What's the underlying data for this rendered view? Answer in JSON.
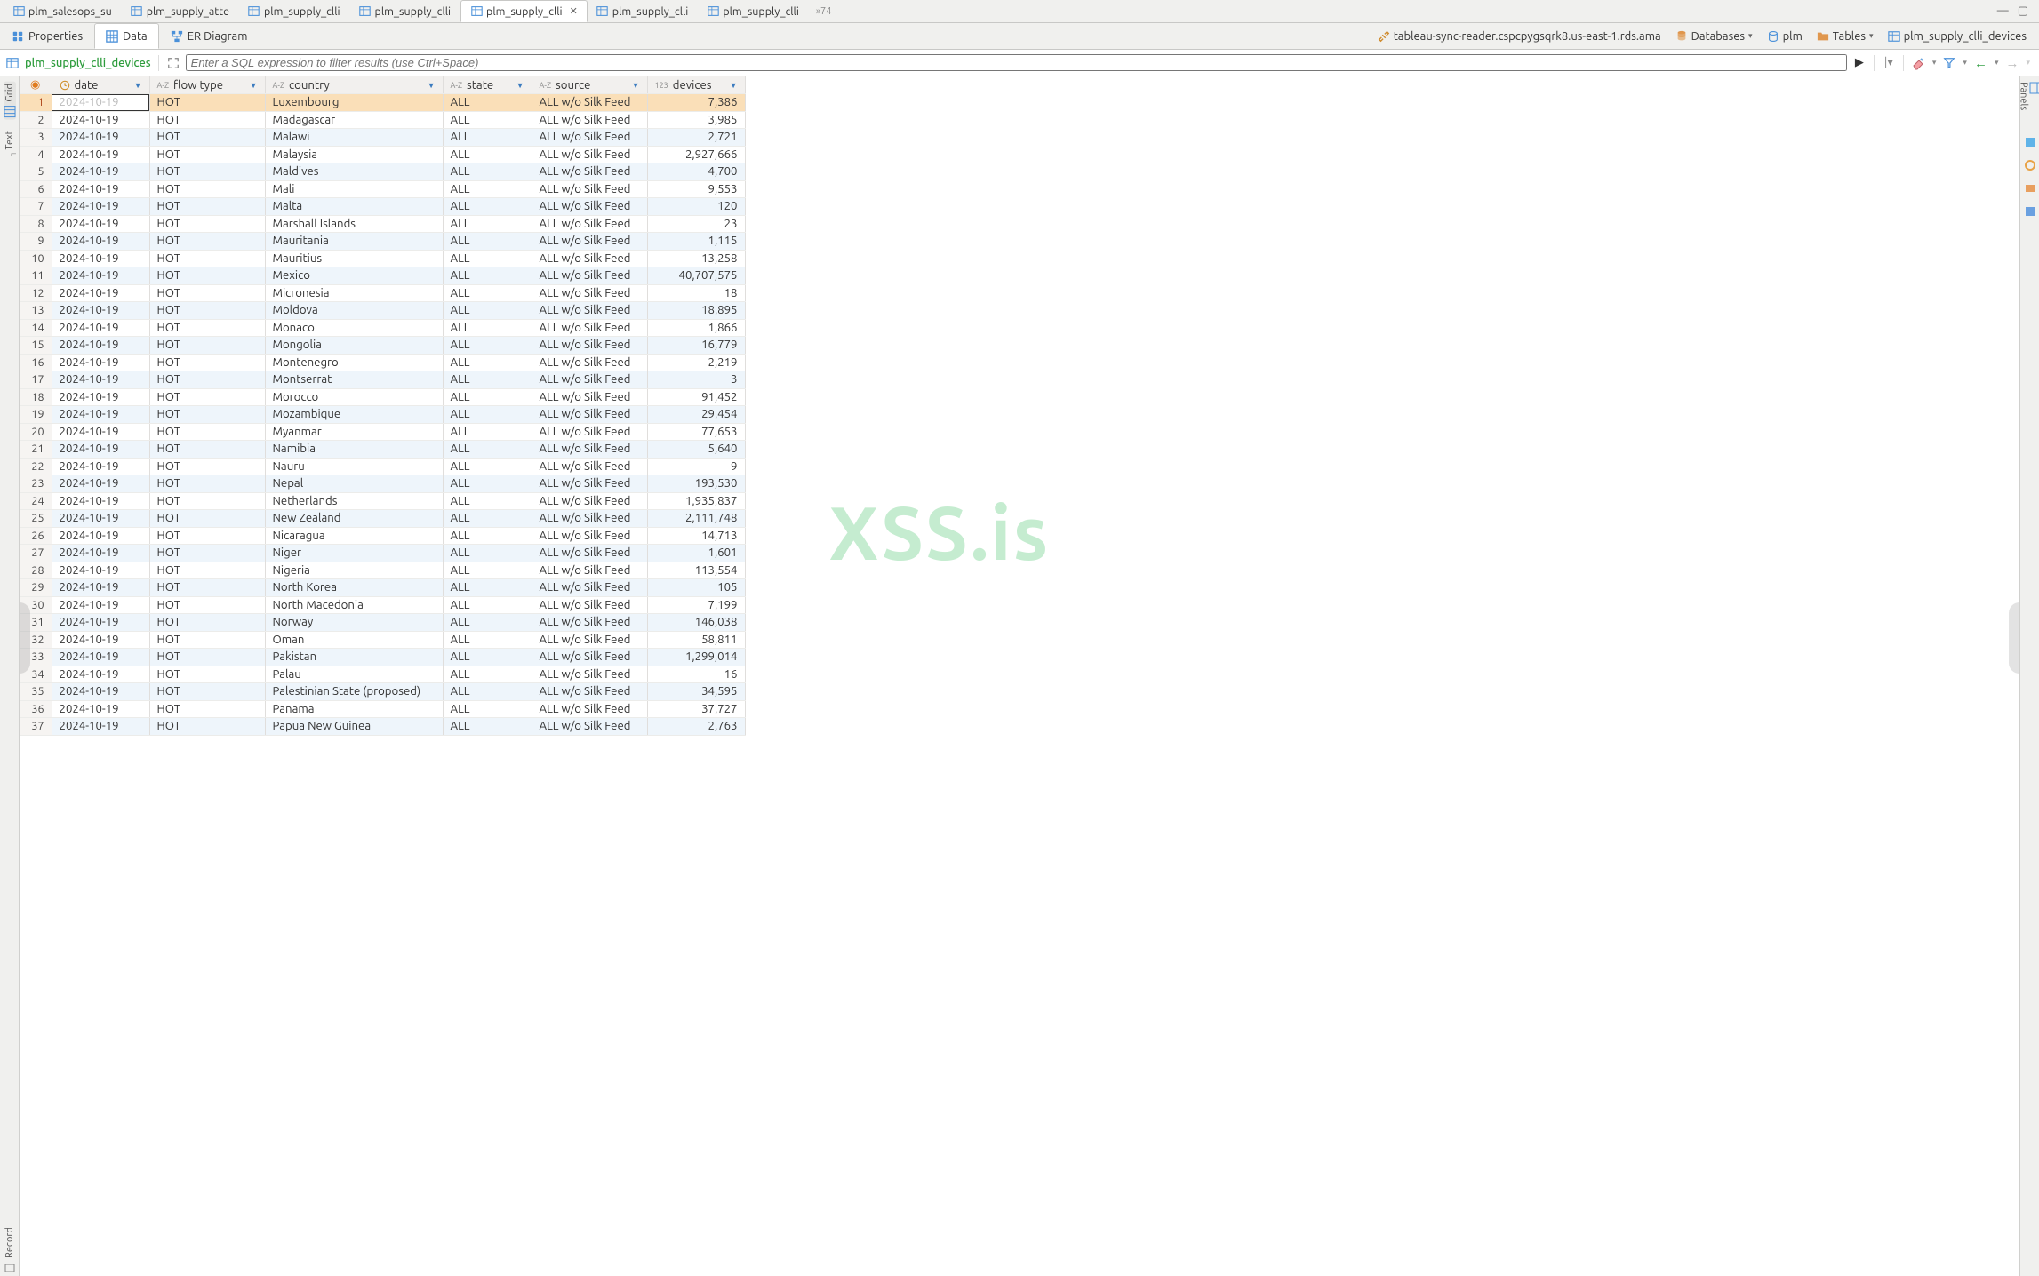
{
  "tabs": [
    {
      "label": "plm_salesops_su"
    },
    {
      "label": "plm_supply_atte"
    },
    {
      "label": "plm_supply_clli"
    },
    {
      "label": "plm_supply_clli"
    },
    {
      "label": "plm_supply_clli",
      "active": true
    },
    {
      "label": "plm_supply_clli"
    },
    {
      "label": "plm_supply_clli"
    }
  ],
  "tab_overflow": "»74",
  "subtabs": {
    "properties": "Properties",
    "data": "Data",
    "er": "ER Diagram"
  },
  "breadcrumb": {
    "connection": "tableau-sync-reader.cspcpygsqrk8.us-east-1.rds.ama",
    "databases": "Databases",
    "db": "plm",
    "tables": "Tables",
    "table": "plm_supply_clli_devices"
  },
  "actionbar": {
    "table_name": "plm_supply_clli_devices",
    "filter_placeholder": "Enter a SQL expression to filter results (use Ctrl+Space)"
  },
  "left_rail": {
    "grid": "Grid",
    "text": "Text",
    "record": "Record"
  },
  "right_rail": {
    "panels": "Panels"
  },
  "columns": [
    {
      "key": "date",
      "label": "date",
      "type_icon": "clock"
    },
    {
      "key": "flow_type",
      "label": "flow type",
      "type_icon": "az"
    },
    {
      "key": "country",
      "label": "country",
      "type_icon": "az"
    },
    {
      "key": "state",
      "label": "state",
      "type_icon": "az"
    },
    {
      "key": "source",
      "label": "source",
      "type_icon": "az"
    },
    {
      "key": "devices",
      "label": "devices",
      "type_icon": "123",
      "numeric": true
    }
  ],
  "rows": [
    {
      "date": "2024-10-19",
      "flow_type": "HOT",
      "country": "Luxembourg",
      "state": "ALL",
      "source": "ALL w/o Silk Feed",
      "devices": "7,386"
    },
    {
      "date": "2024-10-19",
      "flow_type": "HOT",
      "country": "Madagascar",
      "state": "ALL",
      "source": "ALL w/o Silk Feed",
      "devices": "3,985"
    },
    {
      "date": "2024-10-19",
      "flow_type": "HOT",
      "country": "Malawi",
      "state": "ALL",
      "source": "ALL w/o Silk Feed",
      "devices": "2,721"
    },
    {
      "date": "2024-10-19",
      "flow_type": "HOT",
      "country": "Malaysia",
      "state": "ALL",
      "source": "ALL w/o Silk Feed",
      "devices": "2,927,666"
    },
    {
      "date": "2024-10-19",
      "flow_type": "HOT",
      "country": "Maldives",
      "state": "ALL",
      "source": "ALL w/o Silk Feed",
      "devices": "4,700"
    },
    {
      "date": "2024-10-19",
      "flow_type": "HOT",
      "country": "Mali",
      "state": "ALL",
      "source": "ALL w/o Silk Feed",
      "devices": "9,553"
    },
    {
      "date": "2024-10-19",
      "flow_type": "HOT",
      "country": "Malta",
      "state": "ALL",
      "source": "ALL w/o Silk Feed",
      "devices": "120"
    },
    {
      "date": "2024-10-19",
      "flow_type": "HOT",
      "country": "Marshall Islands",
      "state": "ALL",
      "source": "ALL w/o Silk Feed",
      "devices": "23"
    },
    {
      "date": "2024-10-19",
      "flow_type": "HOT",
      "country": "Mauritania",
      "state": "ALL",
      "source": "ALL w/o Silk Feed",
      "devices": "1,115"
    },
    {
      "date": "2024-10-19",
      "flow_type": "HOT",
      "country": "Mauritius",
      "state": "ALL",
      "source": "ALL w/o Silk Feed",
      "devices": "13,258"
    },
    {
      "date": "2024-10-19",
      "flow_type": "HOT",
      "country": "Mexico",
      "state": "ALL",
      "source": "ALL w/o Silk Feed",
      "devices": "40,707,575"
    },
    {
      "date": "2024-10-19",
      "flow_type": "HOT",
      "country": "Micronesia",
      "state": "ALL",
      "source": "ALL w/o Silk Feed",
      "devices": "18"
    },
    {
      "date": "2024-10-19",
      "flow_type": "HOT",
      "country": "Moldova",
      "state": "ALL",
      "source": "ALL w/o Silk Feed",
      "devices": "18,895"
    },
    {
      "date": "2024-10-19",
      "flow_type": "HOT",
      "country": "Monaco",
      "state": "ALL",
      "source": "ALL w/o Silk Feed",
      "devices": "1,866"
    },
    {
      "date": "2024-10-19",
      "flow_type": "HOT",
      "country": "Mongolia",
      "state": "ALL",
      "source": "ALL w/o Silk Feed",
      "devices": "16,779"
    },
    {
      "date": "2024-10-19",
      "flow_type": "HOT",
      "country": "Montenegro",
      "state": "ALL",
      "source": "ALL w/o Silk Feed",
      "devices": "2,219"
    },
    {
      "date": "2024-10-19",
      "flow_type": "HOT",
      "country": "Montserrat",
      "state": "ALL",
      "source": "ALL w/o Silk Feed",
      "devices": "3"
    },
    {
      "date": "2024-10-19",
      "flow_type": "HOT",
      "country": "Morocco",
      "state": "ALL",
      "source": "ALL w/o Silk Feed",
      "devices": "91,452"
    },
    {
      "date": "2024-10-19",
      "flow_type": "HOT",
      "country": "Mozambique",
      "state": "ALL",
      "source": "ALL w/o Silk Feed",
      "devices": "29,454"
    },
    {
      "date": "2024-10-19",
      "flow_type": "HOT",
      "country": "Myanmar",
      "state": "ALL",
      "source": "ALL w/o Silk Feed",
      "devices": "77,653"
    },
    {
      "date": "2024-10-19",
      "flow_type": "HOT",
      "country": "Namibia",
      "state": "ALL",
      "source": "ALL w/o Silk Feed",
      "devices": "5,640"
    },
    {
      "date": "2024-10-19",
      "flow_type": "HOT",
      "country": "Nauru",
      "state": "ALL",
      "source": "ALL w/o Silk Feed",
      "devices": "9"
    },
    {
      "date": "2024-10-19",
      "flow_type": "HOT",
      "country": "Nepal",
      "state": "ALL",
      "source": "ALL w/o Silk Feed",
      "devices": "193,530"
    },
    {
      "date": "2024-10-19",
      "flow_type": "HOT",
      "country": "Netherlands",
      "state": "ALL",
      "source": "ALL w/o Silk Feed",
      "devices": "1,935,837"
    },
    {
      "date": "2024-10-19",
      "flow_type": "HOT",
      "country": "New Zealand",
      "state": "ALL",
      "source": "ALL w/o Silk Feed",
      "devices": "2,111,748"
    },
    {
      "date": "2024-10-19",
      "flow_type": "HOT",
      "country": "Nicaragua",
      "state": "ALL",
      "source": "ALL w/o Silk Feed",
      "devices": "14,713"
    },
    {
      "date": "2024-10-19",
      "flow_type": "HOT",
      "country": "Niger",
      "state": "ALL",
      "source": "ALL w/o Silk Feed",
      "devices": "1,601"
    },
    {
      "date": "2024-10-19",
      "flow_type": "HOT",
      "country": "Nigeria",
      "state": "ALL",
      "source": "ALL w/o Silk Feed",
      "devices": "113,554"
    },
    {
      "date": "2024-10-19",
      "flow_type": "HOT",
      "country": "North Korea",
      "state": "ALL",
      "source": "ALL w/o Silk Feed",
      "devices": "105"
    },
    {
      "date": "2024-10-19",
      "flow_type": "HOT",
      "country": "North Macedonia",
      "state": "ALL",
      "source": "ALL w/o Silk Feed",
      "devices": "7,199"
    },
    {
      "date": "2024-10-19",
      "flow_type": "HOT",
      "country": "Norway",
      "state": "ALL",
      "source": "ALL w/o Silk Feed",
      "devices": "146,038"
    },
    {
      "date": "2024-10-19",
      "flow_type": "HOT",
      "country": "Oman",
      "state": "ALL",
      "source": "ALL w/o Silk Feed",
      "devices": "58,811"
    },
    {
      "date": "2024-10-19",
      "flow_type": "HOT",
      "country": "Pakistan",
      "state": "ALL",
      "source": "ALL w/o Silk Feed",
      "devices": "1,299,014"
    },
    {
      "date": "2024-10-19",
      "flow_type": "HOT",
      "country": "Palau",
      "state": "ALL",
      "source": "ALL w/o Silk Feed",
      "devices": "16"
    },
    {
      "date": "2024-10-19",
      "flow_type": "HOT",
      "country": "Palestinian State (proposed)",
      "state": "ALL",
      "source": "ALL w/o Silk Feed",
      "devices": "34,595"
    },
    {
      "date": "2024-10-19",
      "flow_type": "HOT",
      "country": "Panama",
      "state": "ALL",
      "source": "ALL w/o Silk Feed",
      "devices": "37,727"
    },
    {
      "date": "2024-10-19",
      "flow_type": "HOT",
      "country": "Papua New Guinea",
      "state": "ALL",
      "source": "ALL w/o Silk Feed",
      "devices": "2,763"
    }
  ],
  "watermark": "XSS.is"
}
